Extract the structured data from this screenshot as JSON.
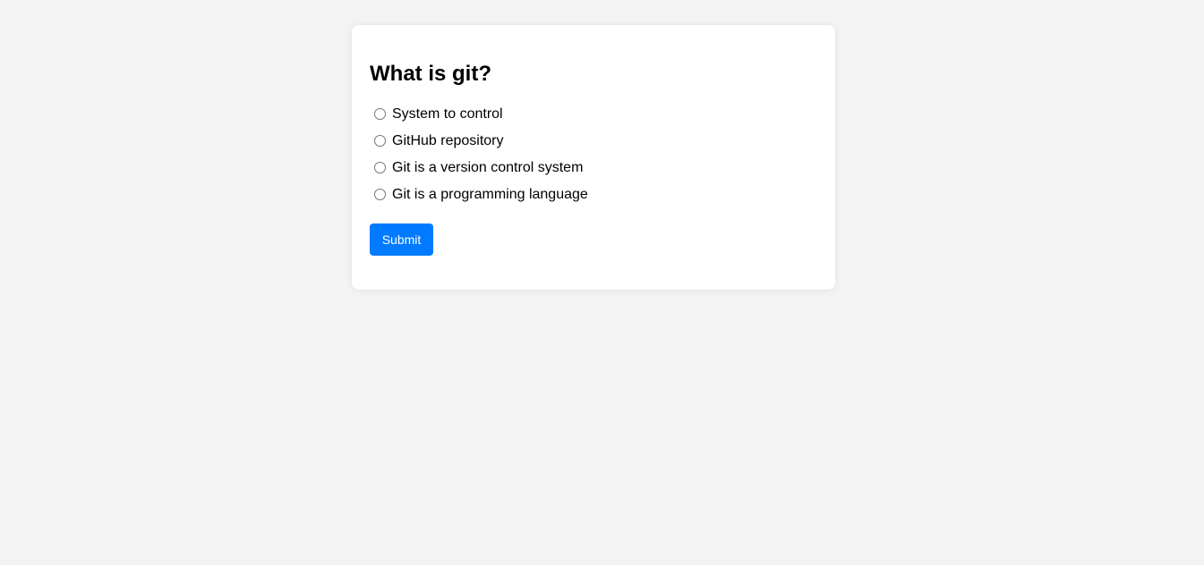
{
  "quiz": {
    "question": "What is git?",
    "options": [
      {
        "label": "System to control",
        "selected": false
      },
      {
        "label": "GitHub repository",
        "selected": false
      },
      {
        "label": "Git is a version control system",
        "selected": false
      },
      {
        "label": "Git is a programming language",
        "selected": false
      }
    ],
    "submit_label": "Submit"
  },
  "colors": {
    "page_background": "#f3f3f3",
    "card_background": "#ffffff",
    "submit_background": "#007bff",
    "submit_text": "#ffffff"
  }
}
